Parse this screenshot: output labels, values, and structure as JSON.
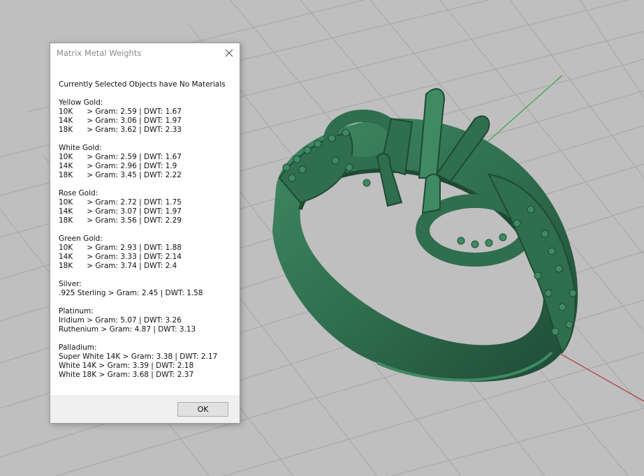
{
  "dialog": {
    "title": "Matrix Metal Weights",
    "heading": "Currently Selected Objects have No Materials",
    "ok_label": "OK",
    "groups": [
      {
        "name": "Yellow Gold:",
        "rows": [
          "10K      > Gram: 2.59 | DWT: 1.67",
          "14K      > Gram: 3.06 | DWT: 1.97",
          "18K      > Gram: 3.62 | DWT: 2.33"
        ]
      },
      {
        "name": "White Gold:",
        "rows": [
          "10K      > Gram: 2.59 | DWT: 1.67",
          "14K      > Gram: 2.96 | DWT: 1.9",
          "18K      > Gram: 3.45 | DWT: 2.22"
        ]
      },
      {
        "name": "Rose Gold:",
        "rows": [
          "10K      > Gram: 2.72 | DWT: 1.75",
          "14K      > Gram: 3.07 | DWT: 1.97",
          "18K      > Gram: 3.56 | DWT: 2.29"
        ]
      },
      {
        "name": "Green Gold:",
        "rows": [
          "10K      > Gram: 2.93 | DWT: 1.88",
          "14K      > Gram: 3.33 | DWT: 2.14",
          "18K      > Gram: 3.74 | DWT: 2.4"
        ]
      },
      {
        "name": "Silver:",
        "rows": [
          ".925 Sterling > Gram: 2.45 | DWT: 1.58"
        ]
      },
      {
        "name": "Platinum:",
        "rows": [
          "Iridium > Gram: 5.07 | DWT: 3.26",
          "Ruthenium > Gram: 4.87 | DWT: 3.13"
        ]
      },
      {
        "name": "Palladium:",
        "rows": [
          "Super White 14K > Gram: 3.38 | DWT: 2.17",
          "White 14K > Gram: 3.39 | DWT: 2.18",
          "White 18K > Gram: 3.68 | DWT: 2.37"
        ]
      }
    ]
  },
  "viewport": {
    "background_color": "#bfbfbf",
    "grid_color": "#a6a6a6",
    "axis_x_color": "#b03a3a",
    "axis_y_color": "#3aa54a",
    "model_color": "#2f6e4e",
    "model_highlight": "#3f8a63",
    "model_shadow": "#1f4a34"
  }
}
